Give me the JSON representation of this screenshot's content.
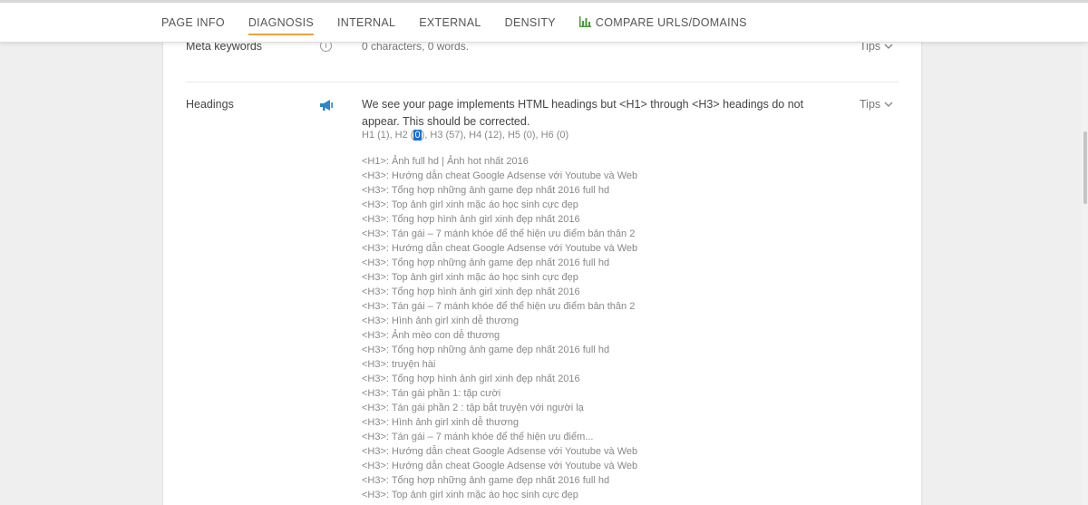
{
  "tabs": [
    {
      "label": "PAGE INFO",
      "active": false
    },
    {
      "label": "DIAGNOSIS",
      "active": true
    },
    {
      "label": "INTERNAL",
      "active": false
    },
    {
      "label": "EXTERNAL",
      "active": false
    },
    {
      "label": "DENSITY",
      "active": false
    },
    {
      "label": "COMPARE URLS/DOMAINS",
      "active": false,
      "icon": "bar-chart-icon"
    }
  ],
  "accent_color": "#e8a33d",
  "meta_keywords": {
    "label": "Meta keywords",
    "value": "0 characters, 0 words.",
    "icon": "info-icon",
    "tips_label": "Tips"
  },
  "headings": {
    "label": "Headings",
    "icon": "megaphone-icon",
    "icon_color": "#2b86c8",
    "message": "We see your page implements HTML headings but <H1> through <H3> headings do not appear. This should be corrected.",
    "counts_prefix": "H1 (1), H2 (",
    "counts_highlight": "0",
    "counts_suffix": "), H3 (57), H4 (12), H5 (0), H6 (0)",
    "tips_label": "Tips",
    "list": [
      "<H1>: Ảnh full hd | Ảnh hot nhất 2016",
      "<H3>: Hướng dẫn cheat Google Adsense với Youtube và Web",
      "<H3>: Tổng hợp những ảnh game đẹp nhất 2016 full hd",
      "<H3>: Top ảnh girl xinh mặc áo học sinh cực đẹp",
      "<H3>: Tổng hợp hình ảnh girl xinh đẹp nhất 2016",
      "<H3>: Tán gái – 7 mánh khóe để thể hiện ưu điểm bản thân 2",
      "<H3>: Hướng dẫn cheat Google Adsense với Youtube và Web",
      "<H3>: Tổng hợp những ảnh game đẹp nhất 2016 full hd",
      "<H3>: Top ảnh girl xinh mặc áo học sinh cực đẹp",
      "<H3>: Tổng hợp hình ảnh girl xinh đẹp nhất 2016",
      "<H3>: Tán gái – 7 mánh khóe để thể hiện ưu điểm bản thân 2",
      "<H3>: Hình ảnh girl xinh dễ thương",
      "<H3>: Ảnh mèo con dễ thương",
      "<H3>: Tổng hợp những ảnh game đẹp nhất 2016 full hd",
      "<H3>: truyện hài",
      "<H3>: Tổng hợp hình ảnh girl xinh đẹp nhất 2016",
      "<H3>: Tán gái phần 1: tập cười",
      "<H3>: Tán gái phần 2 : tập bắt truyện với người lạ",
      "<H3>: Hình ảnh girl xinh dễ thương",
      "<H3>: Tán gái – 7 mánh khóe để thể hiện ưu điểm...",
      "<H3>: Hướng dẫn cheat Google Adsense với Youtube và Web",
      "<H3>: Hướng dẫn cheat Google Adsense với Youtube và Web",
      "<H3>: Tổng hợp những ảnh game đẹp nhất 2016 full hd",
      "<H3>: Top ảnh girl xinh mặc áo học sinh cực đẹp"
    ]
  }
}
